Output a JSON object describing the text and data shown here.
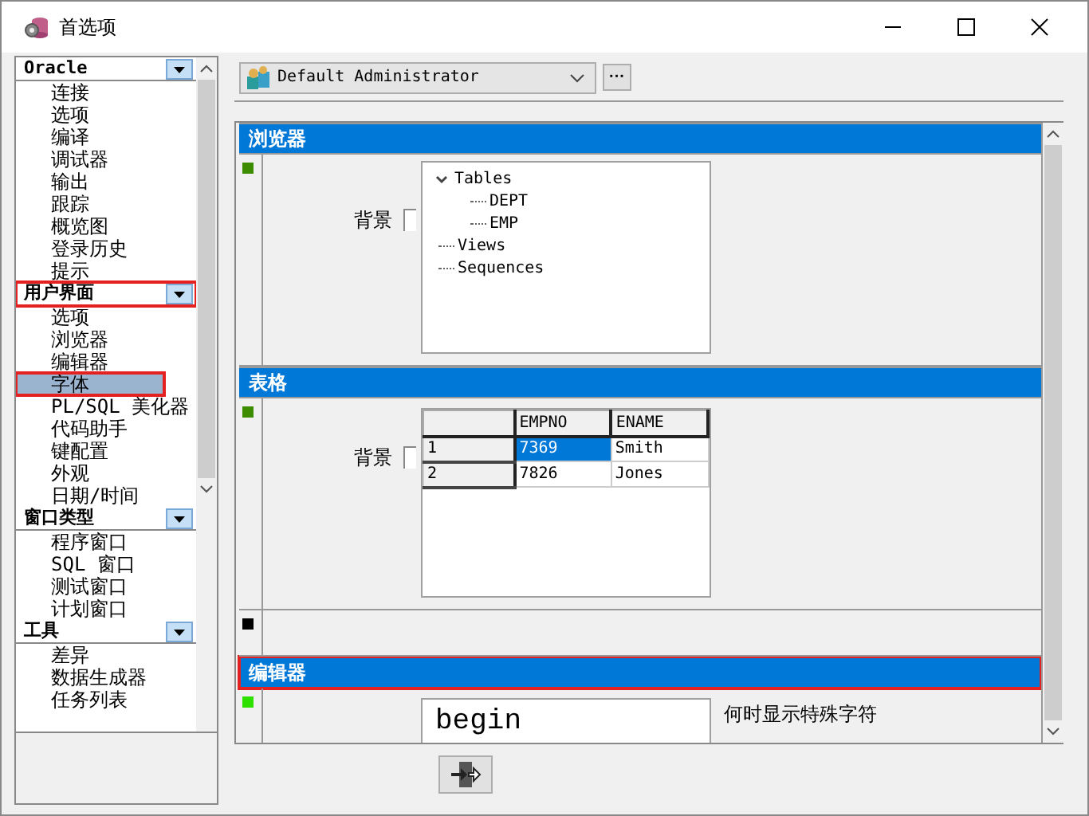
{
  "window": {
    "title": "首选项"
  },
  "sidebar": {
    "groups": [
      {
        "label": "Oracle",
        "highlighted": false,
        "items": [
          {
            "label": "连接",
            "selected": false,
            "highlighted": false
          },
          {
            "label": "选项",
            "selected": false,
            "highlighted": false
          },
          {
            "label": "编译",
            "selected": false,
            "highlighted": false
          },
          {
            "label": "调试器",
            "selected": false,
            "highlighted": false
          },
          {
            "label": "输出",
            "selected": false,
            "highlighted": false
          },
          {
            "label": "跟踪",
            "selected": false,
            "highlighted": false
          },
          {
            "label": "概览图",
            "selected": false,
            "highlighted": false
          },
          {
            "label": "登录历史",
            "selected": false,
            "highlighted": false
          },
          {
            "label": "提示",
            "selected": false,
            "highlighted": false
          }
        ]
      },
      {
        "label": "用户界面",
        "highlighted": true,
        "items": [
          {
            "label": "选项",
            "selected": false,
            "highlighted": false
          },
          {
            "label": "浏览器",
            "selected": false,
            "highlighted": false
          },
          {
            "label": "编辑器",
            "selected": false,
            "highlighted": false
          },
          {
            "label": "字体",
            "selected": true,
            "highlighted": true
          },
          {
            "label": "PL/SQL 美化器",
            "selected": false,
            "highlighted": false
          },
          {
            "label": "代码助手",
            "selected": false,
            "highlighted": false
          },
          {
            "label": "键配置",
            "selected": false,
            "highlighted": false
          },
          {
            "label": "外观",
            "selected": false,
            "highlighted": false
          },
          {
            "label": "日期/时间",
            "selected": false,
            "highlighted": false
          }
        ]
      },
      {
        "label": "窗口类型",
        "highlighted": false,
        "items": [
          {
            "label": "程序窗口",
            "selected": false,
            "highlighted": false
          },
          {
            "label": "SQL 窗口",
            "selected": false,
            "highlighted": false
          },
          {
            "label": "测试窗口",
            "selected": false,
            "highlighted": false
          },
          {
            "label": "计划窗口",
            "selected": false,
            "highlighted": false
          }
        ]
      },
      {
        "label": "工具",
        "highlighted": false,
        "items": [
          {
            "label": "差异",
            "selected": false,
            "highlighted": false
          },
          {
            "label": "数据生成器",
            "selected": false,
            "highlighted": false
          },
          {
            "label": "任务列表",
            "selected": false,
            "highlighted": false
          }
        ]
      }
    ]
  },
  "profile": {
    "value": "Default Administrator",
    "more_button": "···"
  },
  "sections": [
    {
      "kind": "tree",
      "title": "浏览器",
      "color": "#3d8c00",
      "highlighted": false,
      "checkbox": {
        "label": "背景",
        "checked": false
      },
      "tree": [
        {
          "label": "Tables",
          "expanded": true,
          "children": [
            {
              "label": "DEPT"
            },
            {
              "label": "EMP"
            }
          ]
        },
        {
          "label": "Views"
        },
        {
          "label": "Sequences"
        }
      ]
    },
    {
      "kind": "grid",
      "title": "表格",
      "color": "#3d8c00",
      "highlighted": false,
      "checkbox": {
        "label": "背景",
        "checked": false
      },
      "grid": {
        "columns": [
          "EMPNO",
          "ENAME"
        ],
        "rows": [
          {
            "header": "1",
            "cells": [
              {
                "text": "7369",
                "selected": true
              },
              {
                "text": "Smith",
                "selected": false
              }
            ]
          },
          {
            "header": "2",
            "cells": [
              {
                "text": "7826",
                "selected": false
              },
              {
                "text": "Jones",
                "selected": false
              }
            ]
          }
        ]
      }
    },
    {
      "kind": "blank",
      "color": "#000000"
    },
    {
      "kind": "editor",
      "title": "编辑器",
      "color": "#2ee000",
      "highlighted": true,
      "preview": "begin",
      "option": "何时显示特殊字符"
    }
  ]
}
